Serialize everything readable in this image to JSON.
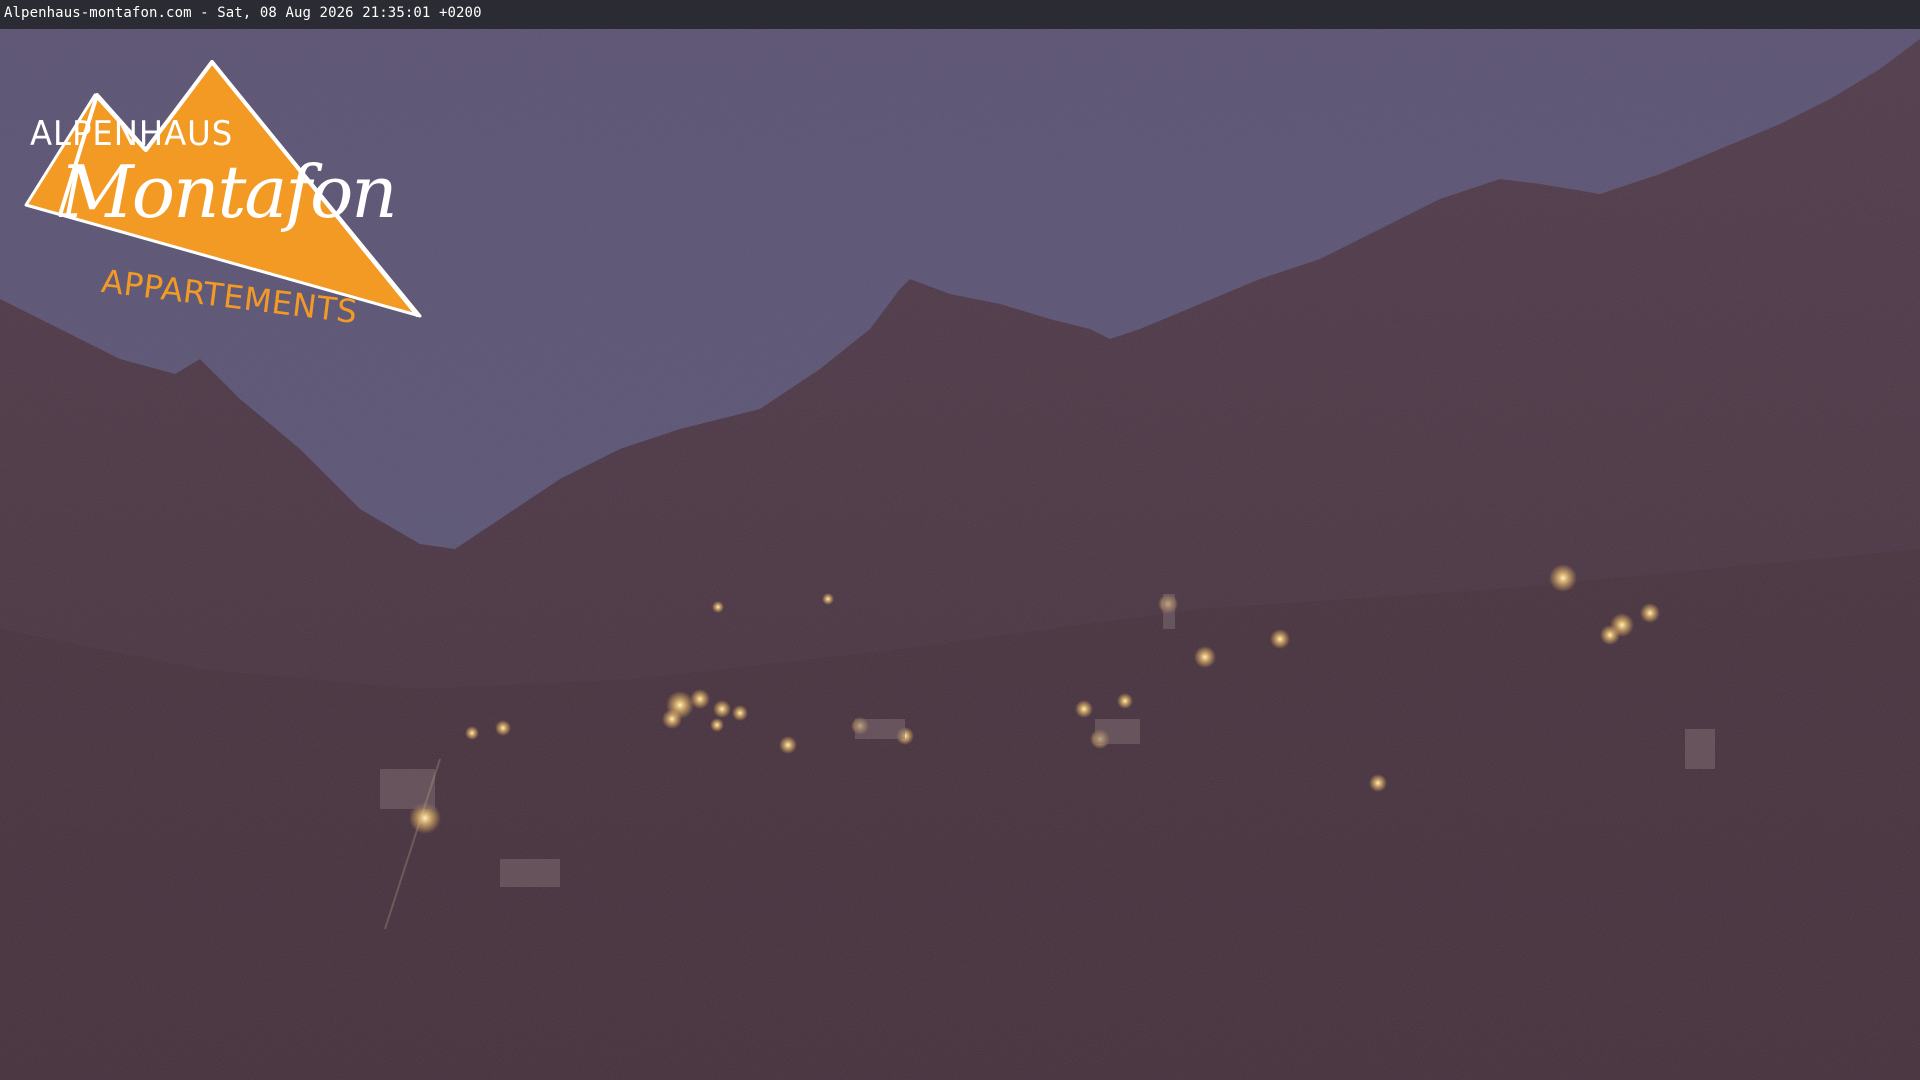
{
  "webcam": {
    "timestamp_line": "Alpenhaus-montafon.com - Sat, 08 Aug 2026 21:35:01 +0200"
  },
  "logo": {
    "line1": "ALPENHAUS",
    "line2": "Montafon",
    "line3": "APPARTEMENTS",
    "colors": {
      "orange": "#f39a24",
      "white": "#ffffff"
    }
  },
  "scene": {
    "description_colors": {
      "sky": "#5c5676",
      "mountain": "#4a3541",
      "valley": "#46323e",
      "lights": "#ffd98a"
    }
  }
}
